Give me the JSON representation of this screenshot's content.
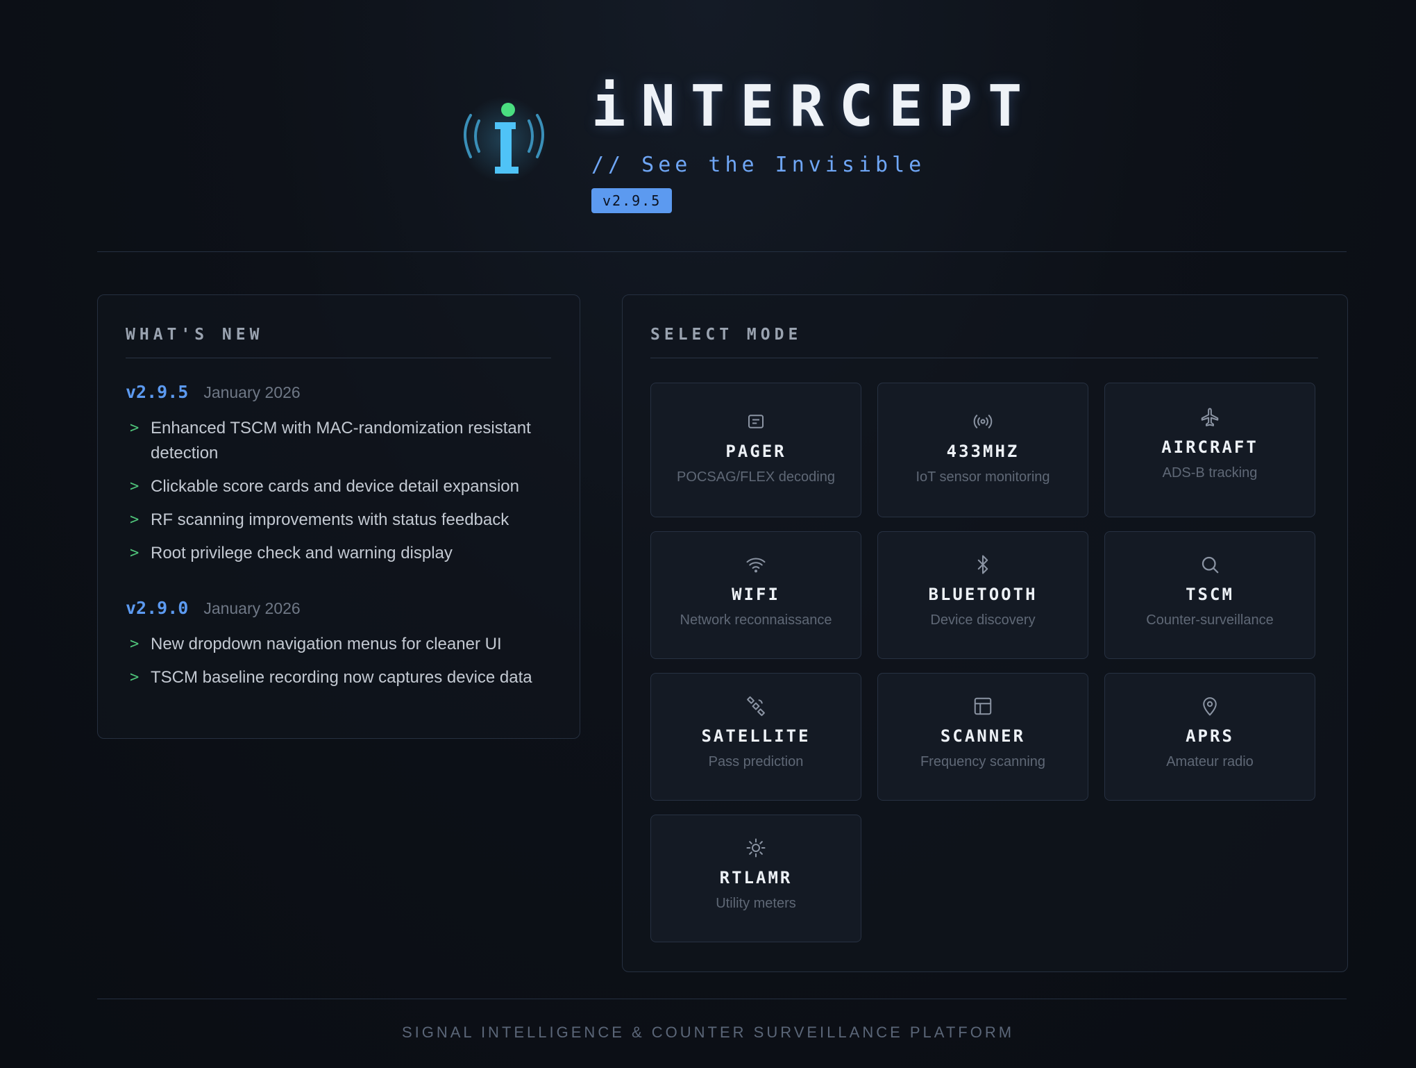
{
  "header": {
    "title": "iNTERCEPT",
    "tagline": "// See the Invisible",
    "version": "v2.9.5"
  },
  "whats_new": {
    "title": "WHAT'S NEW",
    "releases": [
      {
        "version": "v2.9.5",
        "date": "January 2026",
        "items": [
          "Enhanced TSCM with MAC-randomization resistant detection",
          "Clickable score cards and device detail expansion",
          "RF scanning improvements with status feedback",
          "Root privilege check and warning display"
        ]
      },
      {
        "version": "v2.9.0",
        "date": "January 2026",
        "items": [
          "New dropdown navigation menus for cleaner UI",
          "TSCM baseline recording now captures device data"
        ]
      }
    ]
  },
  "select_mode": {
    "title": "SELECT MODE",
    "modes": [
      {
        "name": "PAGER",
        "desc": "POCSAG/FLEX decoding",
        "icon": "pager-icon"
      },
      {
        "name": "433MHZ",
        "desc": "IoT sensor monitoring",
        "icon": "radio-waves-icon"
      },
      {
        "name": "AIRCRAFT",
        "desc": "ADS-B tracking",
        "icon": "plane-icon"
      },
      {
        "name": "WIFI",
        "desc": "Network reconnaissance",
        "icon": "wifi-icon"
      },
      {
        "name": "BLUETOOTH",
        "desc": "Device discovery",
        "icon": "bluetooth-icon"
      },
      {
        "name": "TSCM",
        "desc": "Counter-surveillance",
        "icon": "search-icon"
      },
      {
        "name": "SATELLITE",
        "desc": "Pass prediction",
        "icon": "satellite-icon"
      },
      {
        "name": "SCANNER",
        "desc": "Frequency scanning",
        "icon": "layout-icon"
      },
      {
        "name": "APRS",
        "desc": "Amateur radio",
        "icon": "map-pin-icon"
      },
      {
        "name": "RTLAMR",
        "desc": "Utility meters",
        "icon": "sun-icon"
      }
    ]
  },
  "footer": {
    "text": "SIGNAL INTELLIGENCE & COUNTER SURVEILLANCE PLATFORM"
  },
  "colors": {
    "accent": "#5c9af0",
    "logo_cyan": "#4fc3f7",
    "logo_dot": "#4ade80",
    "bullet_green": "#4fc47a"
  }
}
